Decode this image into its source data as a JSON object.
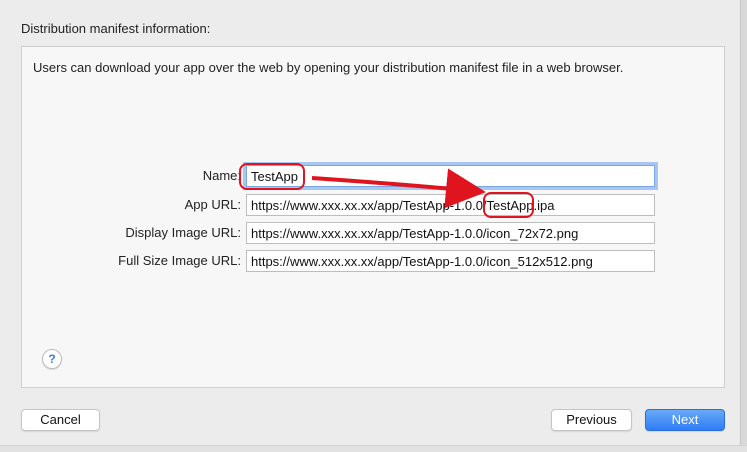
{
  "section_title": "Distribution manifest information:",
  "description": "Users can download your app over the web by opening your distribution manifest file in a web browser.",
  "fields": [
    {
      "label": "Name:",
      "value": "TestApp"
    },
    {
      "label": "App URL:",
      "value": "https://www.xxx.xx.xx/app/TestApp-1.0.0/TestApp.ipa"
    },
    {
      "label": "Display Image URL:",
      "value": "https://www.xxx.xx.xx/app/TestApp-1.0.0/icon_72x72.png"
    },
    {
      "label": "Full Size Image URL:",
      "value": "https://www.xxx.xx.xx/app/TestApp-1.0.0/icon_512x512.png"
    }
  ],
  "help_label": "?",
  "buttons": {
    "cancel": "Cancel",
    "previous": "Previous",
    "next": "Next"
  },
  "colors": {
    "accent": "#2f7cf5",
    "annotation": "#e0141e",
    "focus_ring": "#a7c7f2"
  }
}
